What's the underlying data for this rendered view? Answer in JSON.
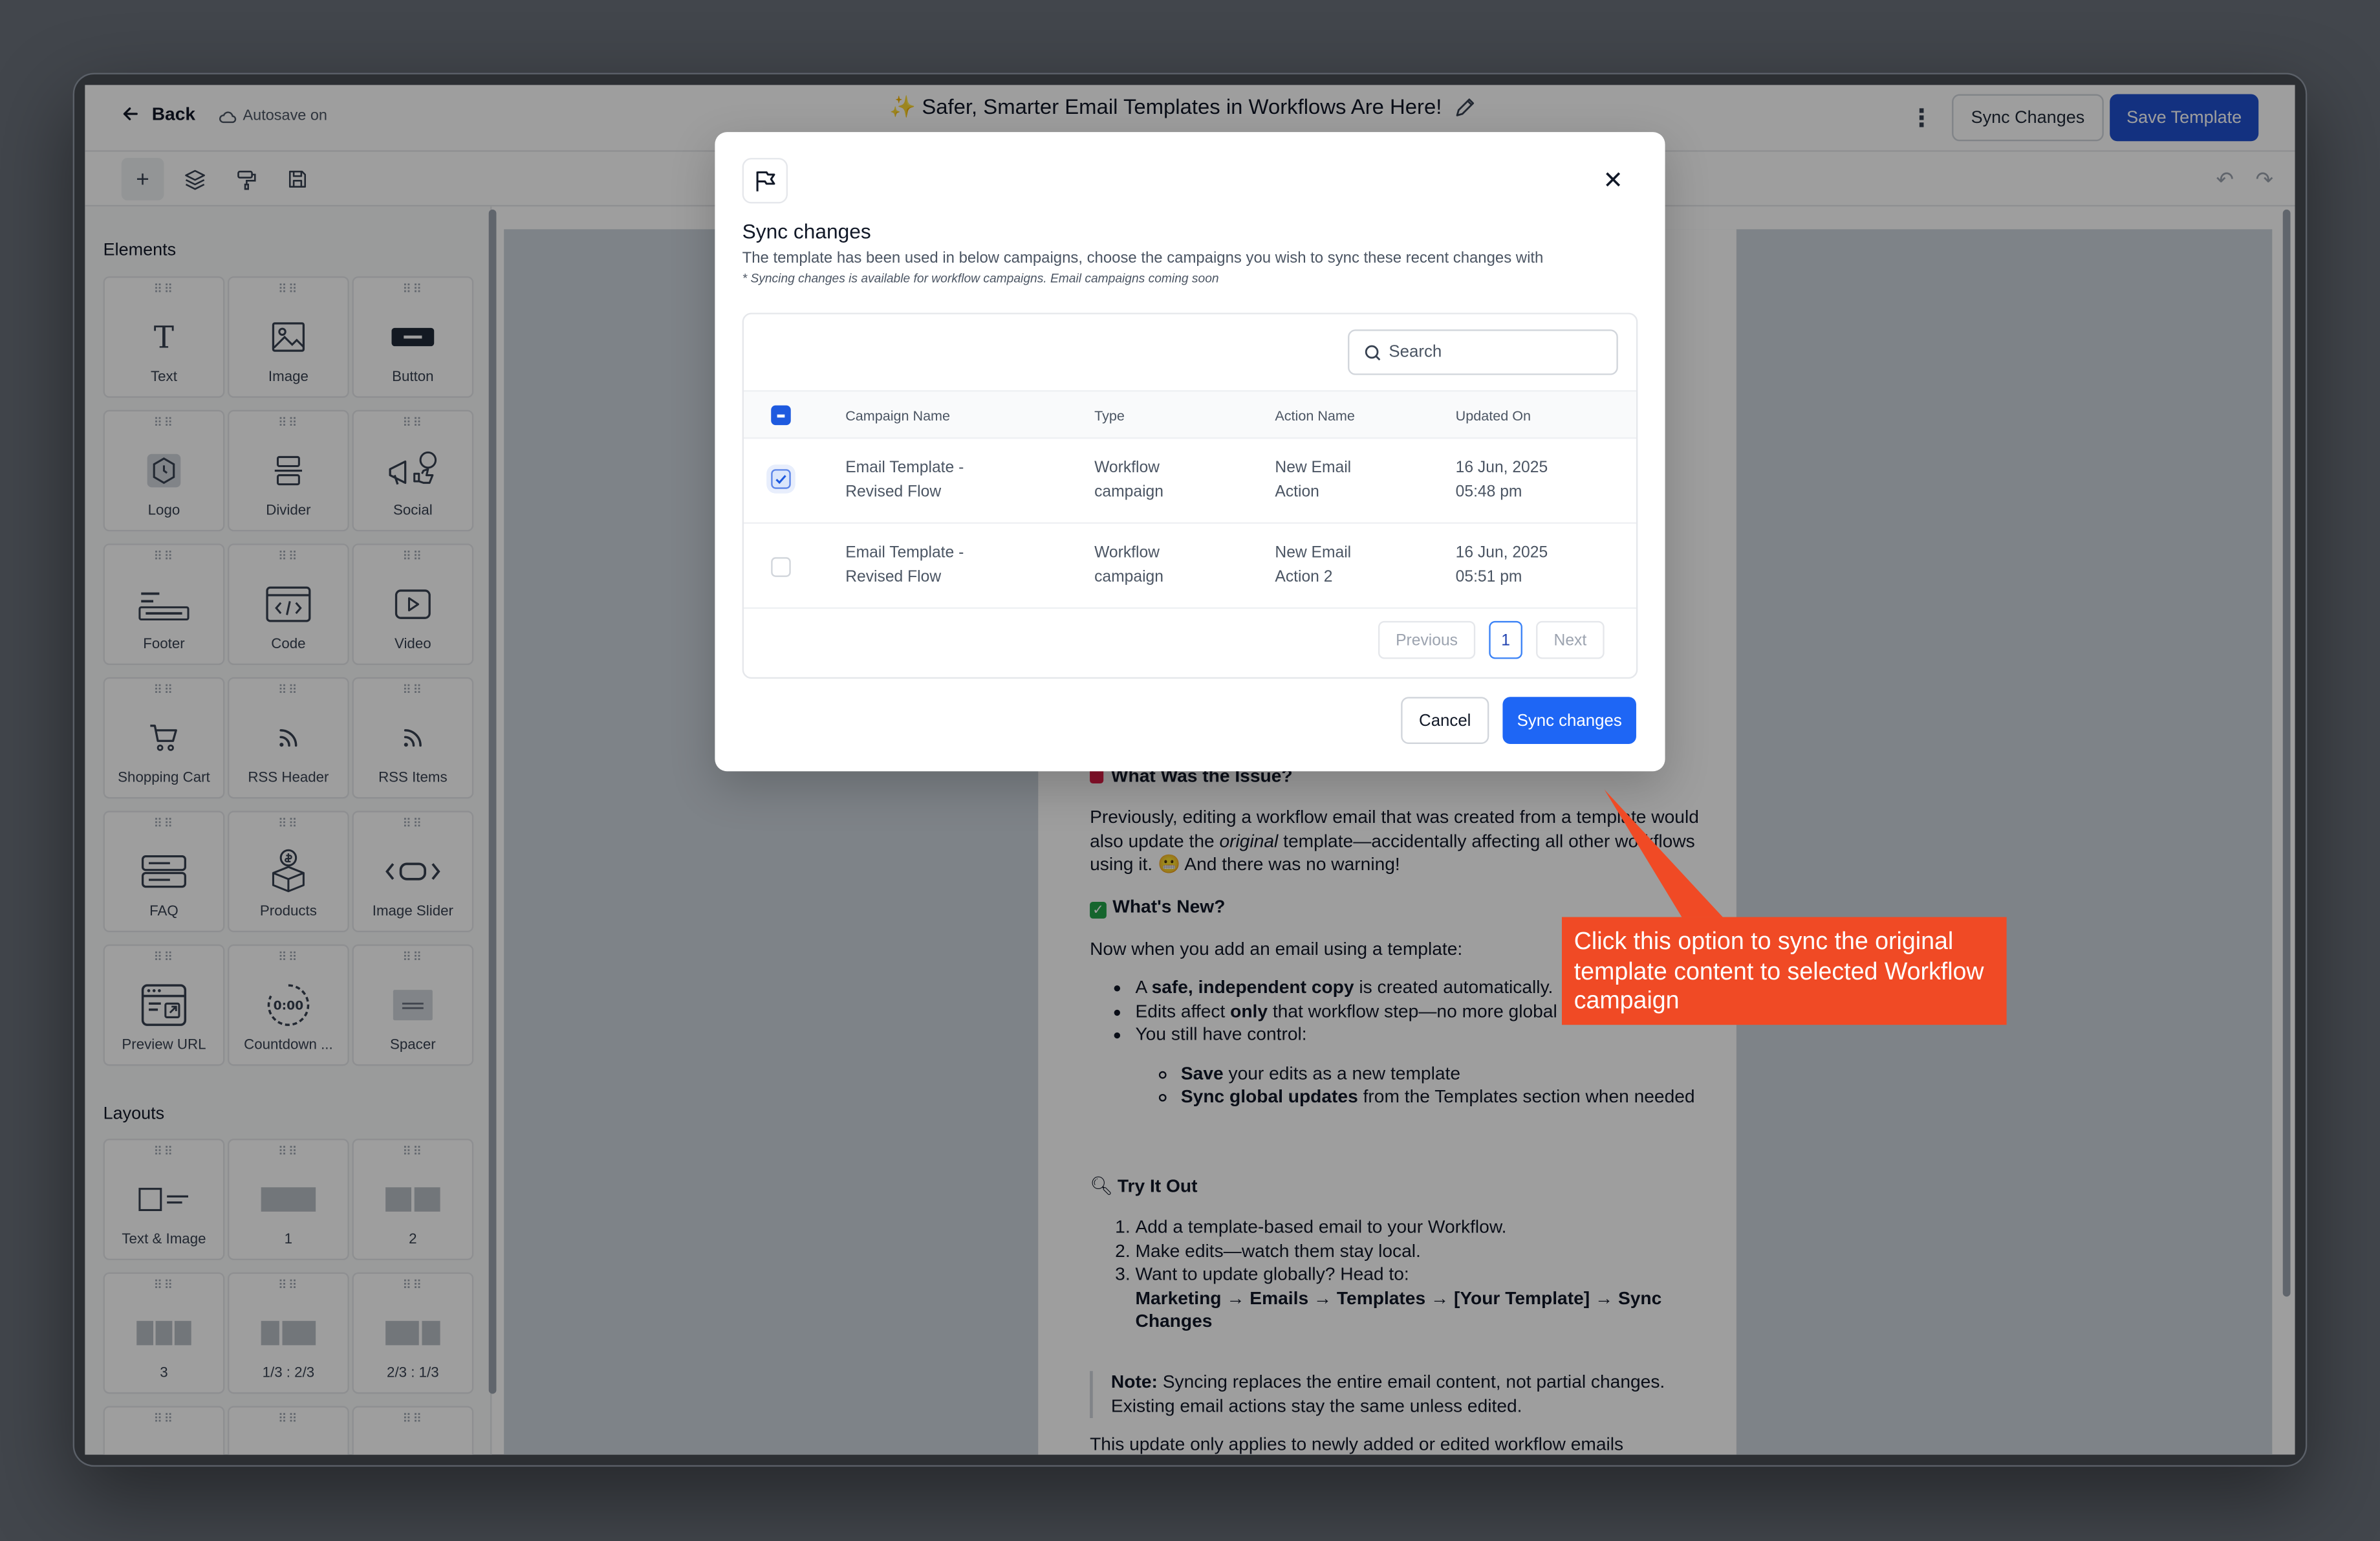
{
  "header": {
    "back_label": "Back",
    "autosave_label": "Autosave on",
    "title": "✨ Safer, Smarter Email Templates in Workflows Are Here!",
    "sync_button": "Sync Changes",
    "save_button": "Save Template"
  },
  "sidebar": {
    "elements_title": "Elements",
    "elements": [
      {
        "label": "Text",
        "icon": "text-icon"
      },
      {
        "label": "Image",
        "icon": "image-icon"
      },
      {
        "label": "Button",
        "icon": "button-icon"
      },
      {
        "label": "Logo",
        "icon": "logo-icon"
      },
      {
        "label": "Divider",
        "icon": "divider-icon"
      },
      {
        "label": "Social",
        "icon": "social-icon"
      },
      {
        "label": "Footer",
        "icon": "footer-icon"
      },
      {
        "label": "Code",
        "icon": "code-icon"
      },
      {
        "label": "Video",
        "icon": "video-icon"
      },
      {
        "label": "Shopping Cart",
        "icon": "cart-icon"
      },
      {
        "label": "RSS Header",
        "icon": "rss-icon"
      },
      {
        "label": "RSS Items",
        "icon": "rss-icon"
      },
      {
        "label": "FAQ",
        "icon": "faq-icon"
      },
      {
        "label": "Products",
        "icon": "products-icon"
      },
      {
        "label": "Image Slider",
        "icon": "slider-icon"
      },
      {
        "label": "Preview URL",
        "icon": "preview-url-icon"
      },
      {
        "label": "Countdown ...",
        "icon": "countdown-icon"
      },
      {
        "label": "Spacer",
        "icon": "spacer-icon"
      }
    ],
    "layouts_title": "Layouts",
    "layouts": [
      {
        "label": "Text & Image"
      },
      {
        "label": "1"
      },
      {
        "label": "2"
      },
      {
        "label": "3"
      },
      {
        "label": "1/3 : 2/3"
      },
      {
        "label": "2/3 : 1/3"
      }
    ]
  },
  "email": {
    "issue_heading": "What Was the Issue?",
    "issue_pre": "Previously, editing a workflow email that was created from a template would also update the ",
    "issue_em": "original",
    "issue_post": " template—accidentally affecting all other workflows using it. 😬 And there was no warning!",
    "new_heading": "What's New?",
    "new_intro": "Now when you add an email using a template:",
    "li1_pre": "A ",
    "li1_bold": "safe, independent copy",
    "li1_post": " is created automatically.",
    "li2_pre": "Edits affect ",
    "li2_bold": "only",
    "li2_post": " that workflow step—no more global surprises.",
    "li3": "You still have control:",
    "sub1_bold": "Save",
    "sub1_post": " your edits as a new template",
    "sub2_bold": "Sync global updates",
    "sub2_post": " from the Templates section when needed",
    "try_heading": "Try It Out",
    "step1": "Add a template-based email to your Workflow.",
    "step2": "Make edits—watch them stay local.",
    "step3": "Want to update globally? Head to:",
    "step3_path": "Marketing → Emails → Templates → [Your Template] → Sync Changes",
    "note_label": "Note:",
    "note_text": " Syncing replaces the entire email content, not partial changes. Existing email actions stay the same unless edited.",
    "footer_line": "This update only applies to newly added or edited workflow emails"
  },
  "modal": {
    "title": "Sync changes",
    "description": "The template has been used in below campaigns, choose the campaigns you wish to sync these recent changes with",
    "note": "* Syncing changes is available for workflow campaigns. Email campaigns coming soon",
    "search_placeholder": "Search",
    "columns": [
      "Campaign Name",
      "Type",
      "Action Name",
      "Updated On"
    ],
    "rows": [
      {
        "checked": true,
        "name_1": "Email Template -",
        "name_2": "Revised Flow",
        "type_1": "Workflow",
        "type_2": "campaign",
        "action_1": "New Email",
        "action_2": "Action",
        "updated_1": "16 Jun, 2025",
        "updated_2": "05:48 pm"
      },
      {
        "checked": false,
        "name_1": "Email Template -",
        "name_2": "Revised Flow",
        "type_1": "Workflow",
        "type_2": "campaign",
        "action_1": "New Email",
        "action_2": "Action 2",
        "updated_1": "16 Jun, 2025",
        "updated_2": "05:51 pm"
      }
    ],
    "pagination": {
      "previous": "Previous",
      "page": "1",
      "next": "Next"
    },
    "cancel_button": "Cancel",
    "sync_button": "Sync changes"
  },
  "callout": {
    "text": "Click this option to sync the original template content to selected Workflow campaign",
    "color": "#f04a25"
  },
  "colors": {
    "primary": "#1f4fcf",
    "modal_primary": "#1e66f5"
  }
}
